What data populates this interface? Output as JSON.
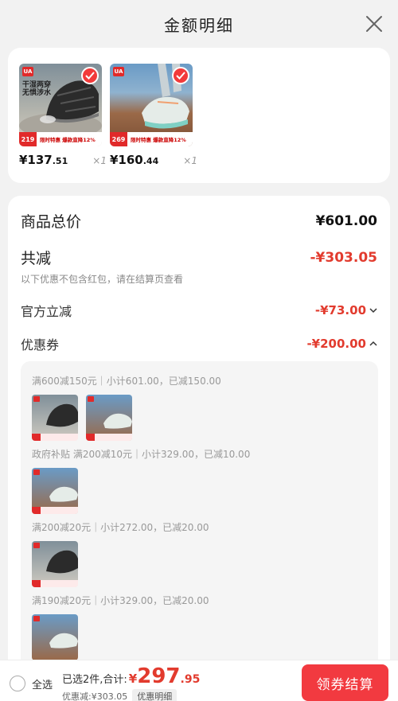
{
  "header": {
    "title": "金额明细",
    "close_icon": "close-icon"
  },
  "products": [
    {
      "price_int": "¥137",
      "price_dec": ".51",
      "qty": "×1",
      "tag_price": "219",
      "promo": "限时特惠 爆款直降12%",
      "overlay": "干湿两穿\n无惧涉水",
      "colors": {
        "bg_top": "#8b9aa4",
        "bg_bottom": "#c8c4bc",
        "shoe": "#2a2a2a"
      }
    },
    {
      "price_int": "¥160",
      "price_dec": ".44",
      "qty": "×1",
      "tag_price": "269",
      "promo": "限时特惠 爆款直降12%",
      "overlay": "",
      "colors": {
        "bg_top": "#6f9cc4",
        "bg_bottom": "#a06b4a",
        "shoe": "#dfe9e6"
      }
    }
  ],
  "details": {
    "total_label": "商品总价",
    "total_value": "¥601.00",
    "discount_label": "共减",
    "discount_value": "-¥303.05",
    "discount_note": "以下优惠不包含红包，请在结算页查看",
    "official_label": "官方立减",
    "official_value": "-¥73.00",
    "coupon_label": "优惠券",
    "coupon_value": "-¥200.00",
    "coupon_lines": [
      "满600减150元｜小计601.00，已减150.00",
      "政府补贴 满200减10元｜小计329.00，已减10.00",
      "满200减20元｜小计272.00，已减20.00",
      "满190减20元｜小计329.00，已减20.00"
    ]
  },
  "bottom": {
    "select_all": "全选",
    "selected_text": "已选2件,合计:",
    "currency": "¥",
    "total_int": "297",
    "total_dec": ".95",
    "discount_text": "优惠减:¥303.05",
    "detail_label": "优惠明细",
    "checkout_label": "领券结算"
  },
  "colors": {
    "accent": "#f23a40",
    "price_red": "#e23b2e"
  }
}
